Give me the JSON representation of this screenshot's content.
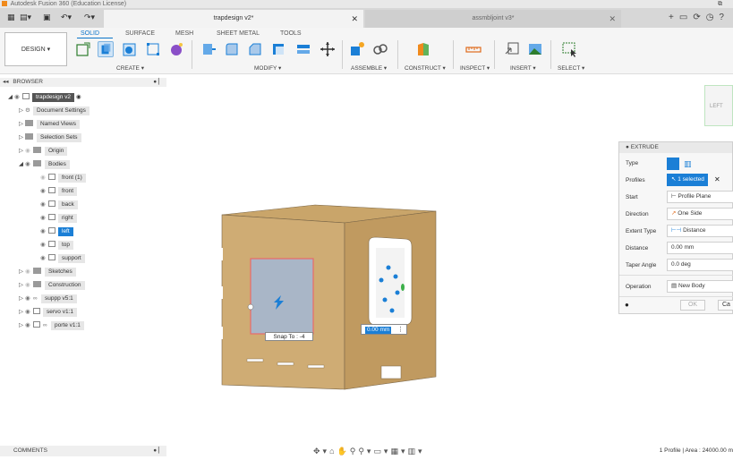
{
  "window": {
    "title": "Autodesk Fusion 360 (Education License)"
  },
  "tabs": [
    {
      "label": "trapdesign v2*",
      "active": true
    },
    {
      "label": "assmbljoint v3*",
      "active": false
    }
  ],
  "ribbon": {
    "design_label": "DESIGN ▾",
    "tabs": [
      "SOLID",
      "SURFACE",
      "MESH",
      "SHEET METAL",
      "TOOLS"
    ],
    "groups": [
      "CREATE ▾",
      "MODIFY ▾",
      "ASSEMBLE ▾",
      "CONSTRUCT ▾",
      "INSPECT ▾",
      "INSERT ▾",
      "SELECT ▾"
    ]
  },
  "browser": {
    "title": "BROWSER",
    "items": [
      {
        "label": "trapdesign v2"
      },
      {
        "label": "Document Settings"
      },
      {
        "label": "Named Views"
      },
      {
        "label": "Selection Sets"
      },
      {
        "label": "Origin"
      },
      {
        "label": "Bodies"
      },
      {
        "label": "front (1)"
      },
      {
        "label": "front"
      },
      {
        "label": "back"
      },
      {
        "label": "right"
      },
      {
        "label": "left"
      },
      {
        "label": "top"
      },
      {
        "label": "support"
      },
      {
        "label": "Sketches"
      },
      {
        "label": "Construction"
      },
      {
        "label": "suppp v5:1"
      },
      {
        "label": "servo v1:1"
      },
      {
        "label": "porte v1:1"
      }
    ]
  },
  "comments": {
    "label": "COMMENTS"
  },
  "extrude": {
    "title": "EXTRUDE",
    "rows": [
      {
        "label": "Type",
        "value": ""
      },
      {
        "label": "Profiles",
        "value": "1 selected"
      },
      {
        "label": "Start",
        "value": "Profile Plane"
      },
      {
        "label": "Direction",
        "value": "One Side"
      },
      {
        "label": "Extent Type",
        "value": "Distance"
      },
      {
        "label": "Distance",
        "value": "0.00 mm"
      },
      {
        "label": "Taper Angle",
        "value": "0.0 deg"
      },
      {
        "label": "Operation",
        "value": "New Body"
      }
    ],
    "ok_label": "OK",
    "cancel_label": "Ca"
  },
  "viewport": {
    "snap_text": "Snap To : -4",
    "distance_value": "0.00 mm",
    "viewcube_label": "LEFT"
  },
  "status": {
    "text": "1 Profile | Area : 24000.00 m"
  }
}
